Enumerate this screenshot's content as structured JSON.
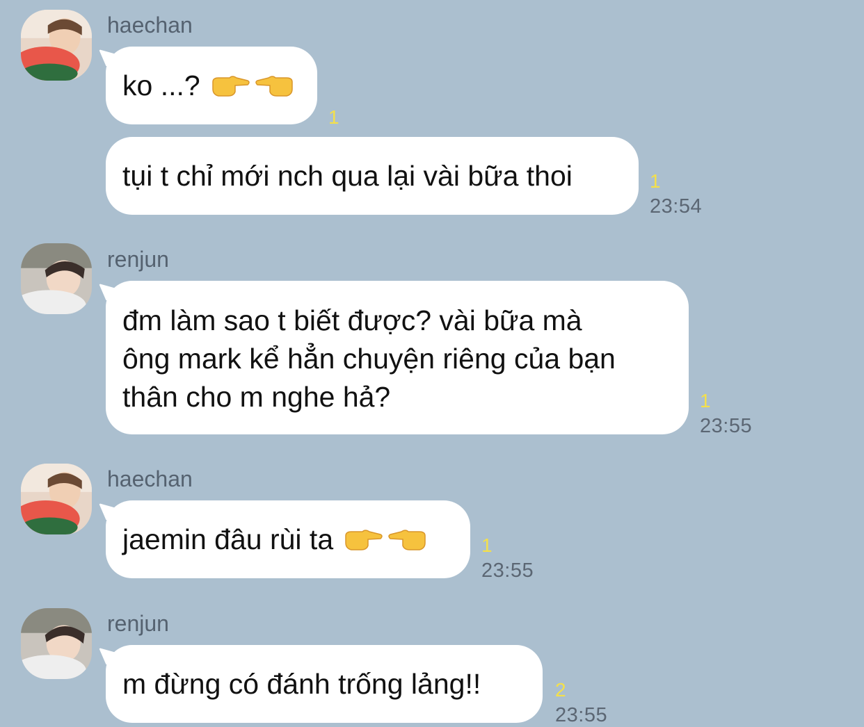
{
  "chat": {
    "messages": [
      {
        "sender": "haechan",
        "text": "ko ...?",
        "emoji": [
          "backhand-index-pointing-right-icon",
          "backhand-index-pointing-left-icon"
        ],
        "unread": "1",
        "time": ""
      },
      {
        "sender": "",
        "text": "tụi t chỉ mới nch qua lại vài bữa thoi",
        "unread": "1",
        "time": "23:54"
      },
      {
        "sender": "renjun",
        "lines": [
          "đm làm sao t biết được? vài bữa mà",
          "ông mark kể hẳn chuyện riêng của bạn",
          "thân cho m nghe hả?"
        ],
        "unread": "1",
        "time": "23:55"
      },
      {
        "sender": "haechan",
        "text": "jaemin đâu rùi ta",
        "emoji": [
          "backhand-index-pointing-right-icon",
          "backhand-index-pointing-left-icon"
        ],
        "unread": "1",
        "time": "23:55"
      },
      {
        "sender": "renjun",
        "text": "m đừng có đánh trống lảng!!",
        "unread": "2",
        "time": "23:55"
      }
    ]
  },
  "colors": {
    "background": "#abbfcf",
    "bubble": "#ffffff",
    "unread": "#f4e04a",
    "time": "#5b6673"
  }
}
